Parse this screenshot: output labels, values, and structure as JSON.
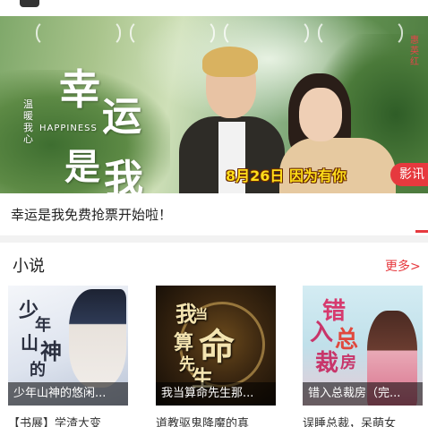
{
  "banner": {
    "title_chars": [
      "幸",
      "运",
      "是",
      "我"
    ],
    "title_en": "HAPPINESS",
    "side_text_left": "温暖我心",
    "side_text_right": "惠英红",
    "date_text": "8月26日  因为有你",
    "pill_label": "影讯"
  },
  "headline": "幸运是我免费抢票开始啦！",
  "section": {
    "title": "小说",
    "more_label": "更多>"
  },
  "books": [
    {
      "overlay": "少年山神的悠闲...",
      "desc": "【书展】学渣大变",
      "cover_chars": [
        "少",
        "年",
        "山",
        "神",
        "的"
      ]
    },
    {
      "overlay": "我当算命先生那...",
      "desc": "道教驱鬼降魔的真",
      "cover_chars": [
        "我",
        "当",
        "算",
        "命",
        "先",
        "生"
      ]
    },
    {
      "overlay": "错入总裁房（完...",
      "desc": "误睡总裁，呆萌女",
      "cover_chars": [
        "错",
        "入",
        "总",
        "裁",
        "房"
      ]
    }
  ],
  "colors": {
    "accent": "#e6393e",
    "date_yellow": "#ffde1a"
  }
}
